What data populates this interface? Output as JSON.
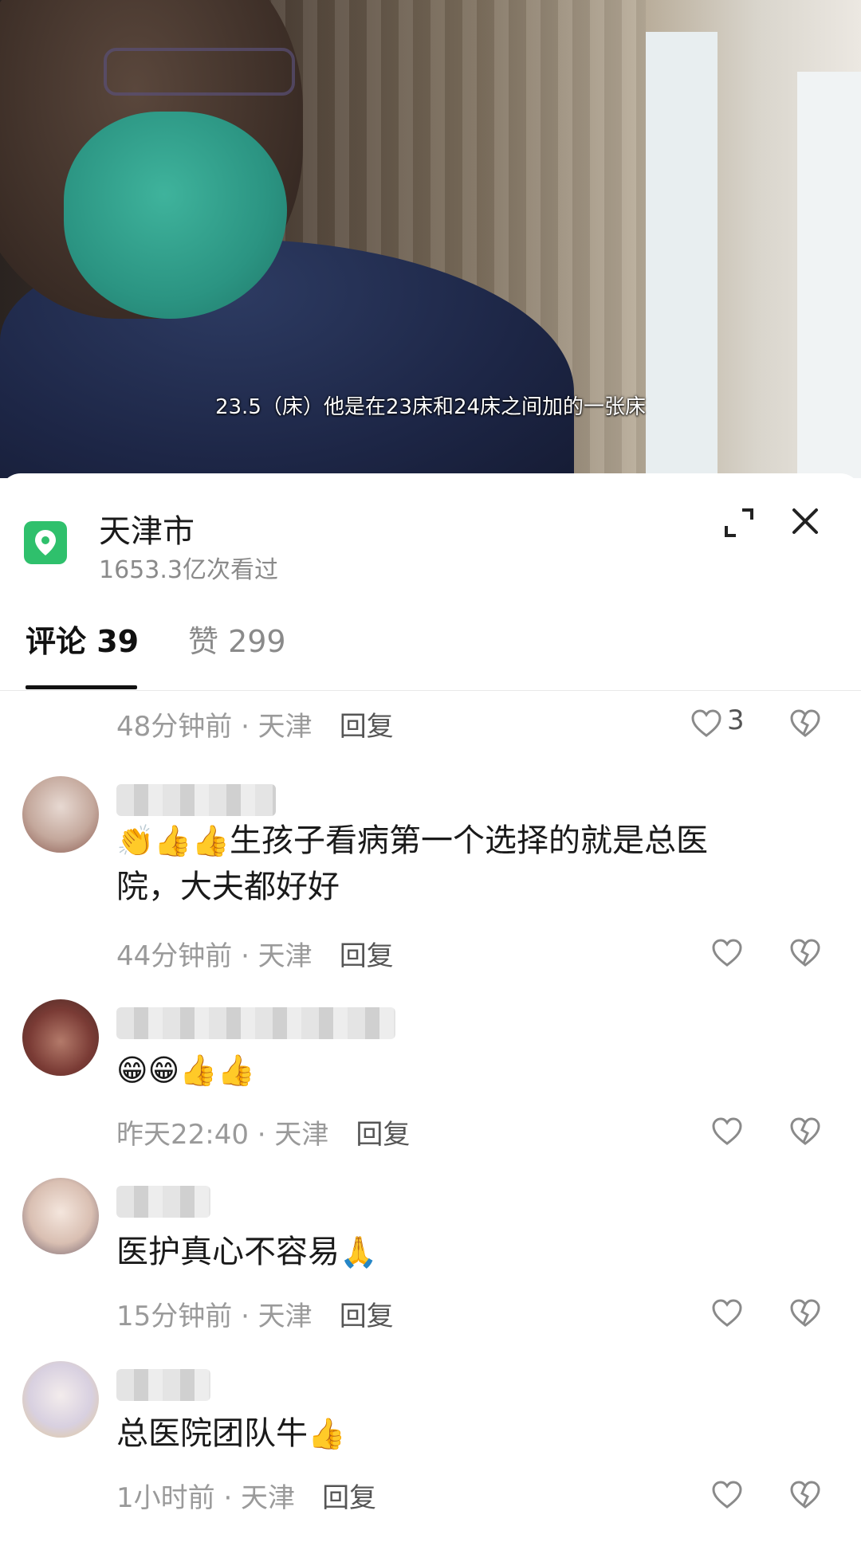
{
  "video": {
    "subtitle": "23.5（床）他是在23床和24床之间加的一张床"
  },
  "location": {
    "title": "天津市",
    "views": "1653.3亿次看过"
  },
  "tabs": {
    "comments": "评论 39",
    "likes": "赞 299"
  },
  "icons": {
    "location": "map-pin-icon",
    "expand": "expand-icon",
    "close": "close-icon",
    "like": "heart-icon",
    "dislike": "broken-heart-icon"
  },
  "colors": {
    "location_badge": "#2fc06c",
    "meta_text": "#9a9a9a",
    "reply_text": "#555555"
  },
  "comments": [
    {
      "time": "48分钟前 · 天津",
      "reply": "回复",
      "likes": "3"
    },
    {
      "text_emoji": "👏👍👍",
      "text": "生孩子看病第一个选择的就是总医",
      "text2": "院，大夫都好好",
      "time": "44分钟前 · 天津",
      "reply": "回复"
    },
    {
      "text_emoji": "😁😁👍👍",
      "time": "昨天22:40 · 天津",
      "reply": "回复"
    },
    {
      "text": "医护真心不容易",
      "text_emoji": "🙏",
      "time": "15分钟前 · 天津",
      "reply": "回复"
    },
    {
      "text": "总医院团队牛",
      "text_emoji": "👍",
      "time": "1小时前 · 天津",
      "reply": "回复"
    }
  ]
}
